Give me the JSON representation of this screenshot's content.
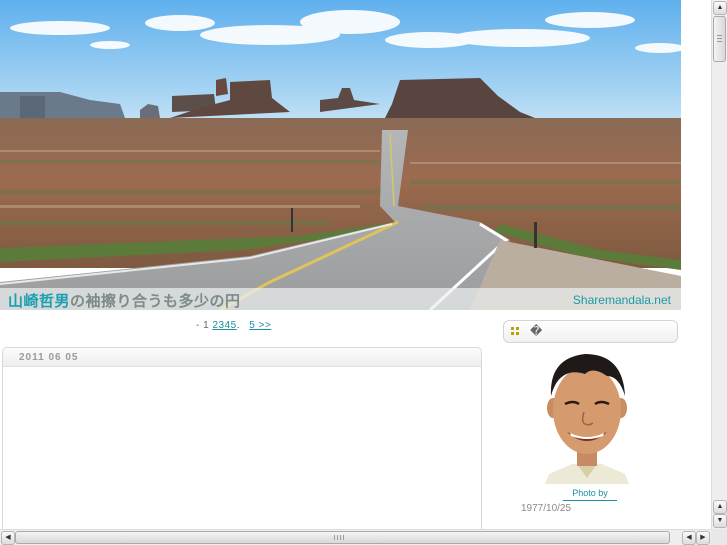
{
  "header": {
    "site_title_accent": "山崎哲男",
    "site_title_rest": "の袖擦り合うも多少の円",
    "site_domain": "Sharemandala.net"
  },
  "pagination": {
    "prefix": "- 1",
    "pages": [
      "2",
      "3",
      "4",
      "5"
    ],
    "separator": ".",
    "next_label": "5 >>"
  },
  "post": {
    "date": "2011 06 05"
  },
  "sidebar": {
    "box_title": "�",
    "photo_link": "Photo by",
    "birth_date": "1977/10/25"
  },
  "scrollbars": {
    "up_arrow": "▲",
    "down_arrow": "▼",
    "left_arrow": "◀",
    "right_arrow": "▶"
  },
  "colors": {
    "accent": "#1aa0b0",
    "link": "#1a8fa0",
    "sky": "#8fc6ef",
    "road": "#a6a8aa"
  }
}
